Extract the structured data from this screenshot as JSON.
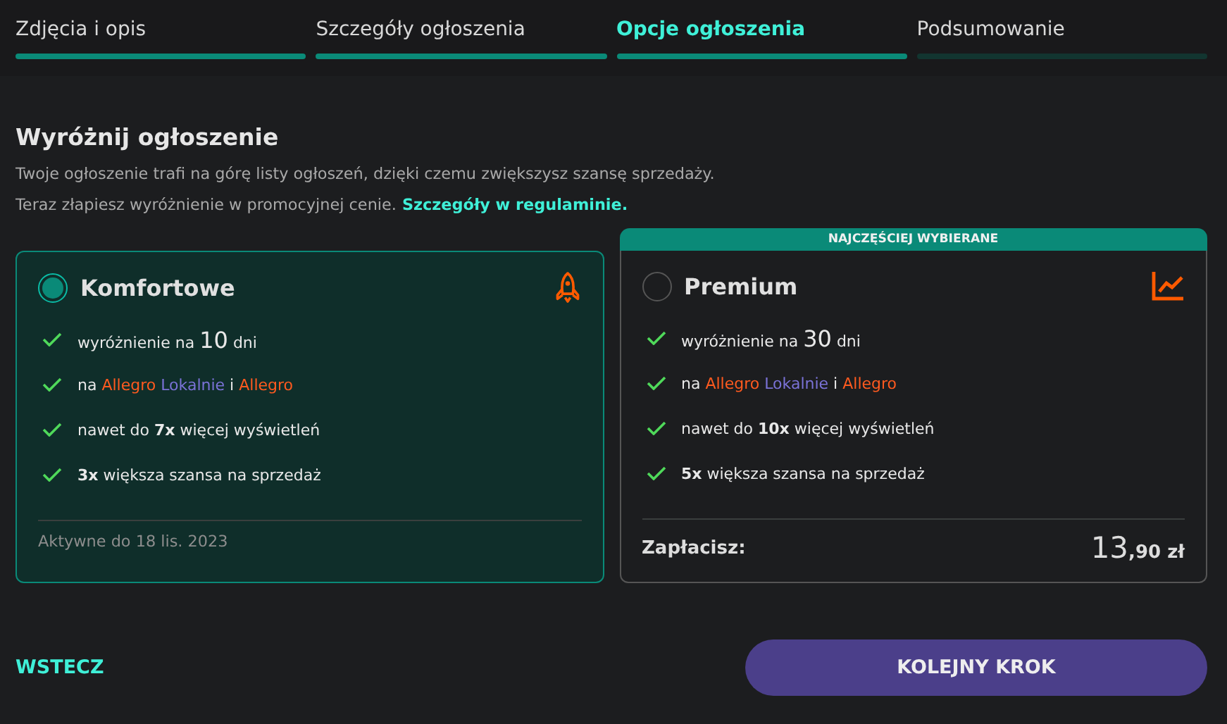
{
  "steps": [
    {
      "label": "Zdjęcia i opis",
      "selected": false,
      "done": true
    },
    {
      "label": "Szczegóły ogłoszenia",
      "selected": false,
      "done": true
    },
    {
      "label": "Opcje ogłoszenia",
      "selected": true,
      "done": true
    },
    {
      "label": "Podsumowanie",
      "selected": false,
      "done": false
    }
  ],
  "section": {
    "title": "Wyróżnij ogłoszenie",
    "lines": [
      "Twoje ogłoszenie trafi na górę listy ogłoszeń, dzięki czemu zwiększysz szansę sprzedaży.",
      "Teraz złapiesz wyróżnienie w promocyjnej cenie."
    ],
    "link": "Szczegóły w regulaminie."
  },
  "plans": [
    {
      "name": "Komfortowe",
      "selected": true,
      "kind": "basic",
      "features": [
        [
          {
            "text": "wyróżnienie na ",
            "kind": "plain"
          },
          {
            "text": "10",
            "kind": "big"
          },
          {
            "text": " dni",
            "kind": "plain"
          }
        ],
        [
          {
            "text": "na ",
            "kind": "plain"
          },
          {
            "text": "Allegro ",
            "kind": "orange"
          },
          {
            "text": "Lokalnie",
            "kind": "violet"
          },
          {
            "text": " i ",
            "kind": "plain"
          },
          {
            "text": "Allegro",
            "kind": "orange"
          }
        ],
        [
          {
            "text": "nawet do ",
            "kind": "plain"
          },
          {
            "text": "7x",
            "kind": "bold"
          },
          {
            "text": " więcej wyświetleń",
            "kind": "plain"
          }
        ],
        [
          {
            "text": "3x",
            "kind": "bold"
          },
          {
            "text": " większa szansa na sprzedaż",
            "kind": "plain"
          }
        ]
      ],
      "footer": {
        "kind": "note",
        "text": "Aktywne do 18 lis. 2023"
      }
    },
    {
      "name": "Premium",
      "selected": false,
      "kind": "premium",
      "badge": "NAJCZĘŚCIEJ WYBIERANE",
      "features": [
        [
          {
            "text": "wyróżnienie na ",
            "kind": "plain"
          },
          {
            "text": "30",
            "kind": "big"
          },
          {
            "text": " dni",
            "kind": "plain"
          }
        ],
        [
          {
            "text": "na ",
            "kind": "plain"
          },
          {
            "text": "Allegro ",
            "kind": "orange"
          },
          {
            "text": "Lokalnie",
            "kind": "violet"
          },
          {
            "text": " i ",
            "kind": "plain"
          },
          {
            "text": "Allegro",
            "kind": "orange"
          }
        ],
        [
          {
            "text": "nawet do ",
            "kind": "plain"
          },
          {
            "text": "10x",
            "kind": "bold"
          },
          {
            "text": " więcej wyświetleń",
            "kind": "plain"
          }
        ],
        [
          {
            "text": "5x",
            "kind": "bold"
          },
          {
            "text": " większa szansa na sprzedaż",
            "kind": "plain"
          }
        ]
      ],
      "footer": {
        "kind": "price",
        "label": "Zapłacisz:",
        "main": "13",
        "fraction": ",90 zł"
      }
    }
  ],
  "back": "WSTECZ",
  "next": "KOLEJNY KROK"
}
